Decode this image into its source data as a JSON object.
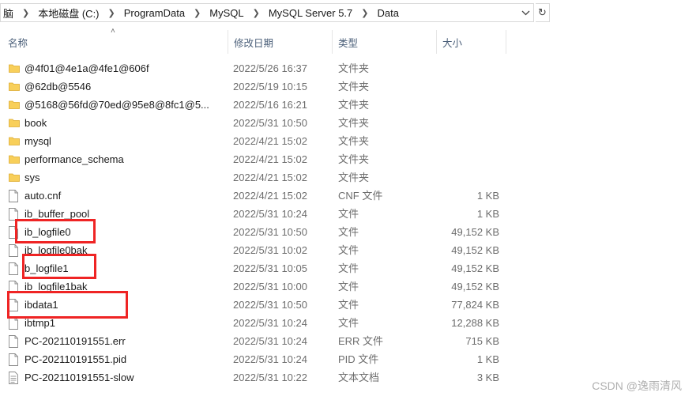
{
  "breadcrumb": [
    "脑",
    "本地磁盘 (C:)",
    "ProgramData",
    "MySQL",
    "MySQL Server 5.7",
    "Data"
  ],
  "columns": {
    "name": "名称",
    "modified": "修改日期",
    "type": "类型",
    "size": "大小"
  },
  "files": [
    {
      "name": "@4f01@4e1a@4fe1@606f",
      "modified": "2022/5/26 16:37",
      "type": "文件夹",
      "size": "",
      "icon": "folder-icon"
    },
    {
      "name": "@62db@5546",
      "modified": "2022/5/19 10:15",
      "type": "文件夹",
      "size": "",
      "icon": "folder-icon"
    },
    {
      "name": "@5168@56fd@70ed@95e8@8fc1@5...",
      "modified": "2022/5/16 16:21",
      "type": "文件夹",
      "size": "",
      "icon": "folder-icon"
    },
    {
      "name": "book",
      "modified": "2022/5/31 10:50",
      "type": "文件夹",
      "size": "",
      "icon": "folder-icon"
    },
    {
      "name": "mysql",
      "modified": "2022/4/21 15:02",
      "type": "文件夹",
      "size": "",
      "icon": "folder-icon"
    },
    {
      "name": "performance_schema",
      "modified": "2022/4/21 15:02",
      "type": "文件夹",
      "size": "",
      "icon": "folder-icon"
    },
    {
      "name": "sys",
      "modified": "2022/4/21 15:02",
      "type": "文件夹",
      "size": "",
      "icon": "folder-icon"
    },
    {
      "name": "auto.cnf",
      "modified": "2022/4/21 15:02",
      "type": "CNF 文件",
      "size": "1 KB",
      "icon": "file-icon"
    },
    {
      "name": "ib_buffer_pool",
      "modified": "2022/5/31 10:24",
      "type": "文件",
      "size": "1 KB",
      "icon": "file-icon"
    },
    {
      "name": "ib_logfile0",
      "modified": "2022/5/31 10:50",
      "type": "文件",
      "size": "49,152 KB",
      "icon": "file-icon"
    },
    {
      "name": "ib_logfile0bak",
      "modified": "2022/5/31 10:02",
      "type": "文件",
      "size": "49,152 KB",
      "icon": "file-icon"
    },
    {
      "name": "b_logfile1",
      "modified": "2022/5/31 10:05",
      "type": "文件",
      "size": "49,152 KB",
      "icon": "file-icon"
    },
    {
      "name": "ib_logfile1bak",
      "modified": "2022/5/31 10:00",
      "type": "文件",
      "size": "49,152 KB",
      "icon": "file-icon"
    },
    {
      "name": "ibdata1",
      "modified": "2022/5/31 10:50",
      "type": "文件",
      "size": "77,824 KB",
      "icon": "file-icon"
    },
    {
      "name": "ibtmp1",
      "modified": "2022/5/31 10:24",
      "type": "文件",
      "size": "12,288 KB",
      "icon": "file-icon"
    },
    {
      "name": "PC-202110191551.err",
      "modified": "2022/5/31 10:24",
      "type": "ERR 文件",
      "size": "715 KB",
      "icon": "file-icon"
    },
    {
      "name": "PC-202110191551.pid",
      "modified": "2022/5/31 10:24",
      "type": "PID 文件",
      "size": "1 KB",
      "icon": "file-icon"
    },
    {
      "name": "PC-202110191551-slow",
      "modified": "2022/5/31 10:22",
      "type": "文本文档",
      "size": "3 KB",
      "icon": "text-file-icon"
    }
  ],
  "watermark": "CSDN @逸雨清风",
  "colors": {
    "annotation": "#ef2424",
    "folder": "#f8cf5a",
    "header_text": "#4c607a"
  }
}
